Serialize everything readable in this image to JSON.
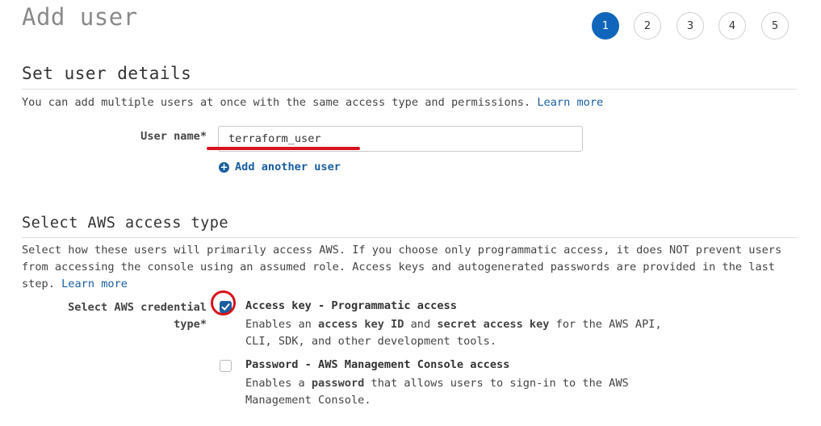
{
  "header": {
    "title": "Add user",
    "steps": [
      "1",
      "2",
      "3",
      "4",
      "5"
    ],
    "active_step": "1"
  },
  "details": {
    "heading": "Set user details",
    "description": "You can add multiple users at once with the same access type and permissions.",
    "learn_more": "Learn more",
    "user_name_label": "User name*",
    "user_name_value": "terraform_user",
    "add_another": "Add another user"
  },
  "access": {
    "heading": "Select AWS access type",
    "description": "Select how these users will primarily access AWS. If you choose only programmatic access, it does NOT prevent users from accessing the console using an assumed role. Access keys and autogenerated passwords are provided in the last step.",
    "learn_more": "Learn more",
    "credential_label_line1": "Select AWS credential",
    "credential_label_line2": "type*",
    "options": [
      {
        "title": "Access key - Programmatic access",
        "desc_parts": [
          "Enables an ",
          "access key ID",
          " and ",
          "secret access key",
          " for the AWS API, CLI, SDK, and other development tools."
        ],
        "checked": true
      },
      {
        "title": "Password - AWS Management Console access",
        "desc_parts": [
          "Enables a ",
          "password",
          " that allows users to sign-in to the AWS Management Console."
        ],
        "checked": false
      }
    ]
  },
  "colors": {
    "accent": "#1166bb",
    "link": "#1a5ea0",
    "highlight": "#d8131d"
  }
}
